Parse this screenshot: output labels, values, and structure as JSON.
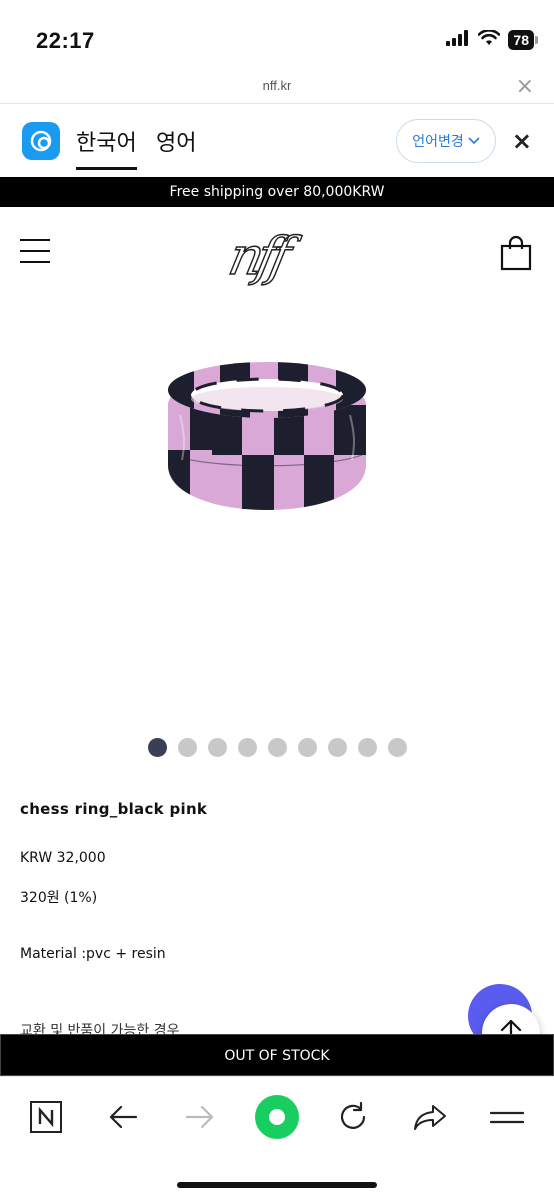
{
  "status_bar": {
    "time": "22:17",
    "battery": "78",
    "icons": [
      "cellular-signal-icon",
      "wifi-icon",
      "battery-icon"
    ]
  },
  "url_bar": {
    "url": "nff.kr",
    "close_label": "×"
  },
  "translate_bar": {
    "languages": [
      "한국어",
      "영어"
    ],
    "change_label": "언어변경",
    "close_label": "×"
  },
  "promo": {
    "text": "Free shipping over 80,000KRW"
  },
  "header": {
    "logo_text": "nff"
  },
  "gallery": {
    "total_slides": 9,
    "active_index": 0
  },
  "product": {
    "name": "chess ring_black pink",
    "price": "KRW 32,000",
    "points": "320원 (1%)",
    "material": "Material :pvc + resin",
    "note": "교환 및 반품이 가능한 경우"
  },
  "actions": {
    "out_of_stock_label": "OUT OF STOCK"
  },
  "colors": {
    "accent_blue": "#1a9af0",
    "chat_button": "#5a5cf0",
    "ring_pink": "#d9a8d6",
    "ring_black": "#1e1f2e",
    "naver_green": "#19ce60"
  }
}
